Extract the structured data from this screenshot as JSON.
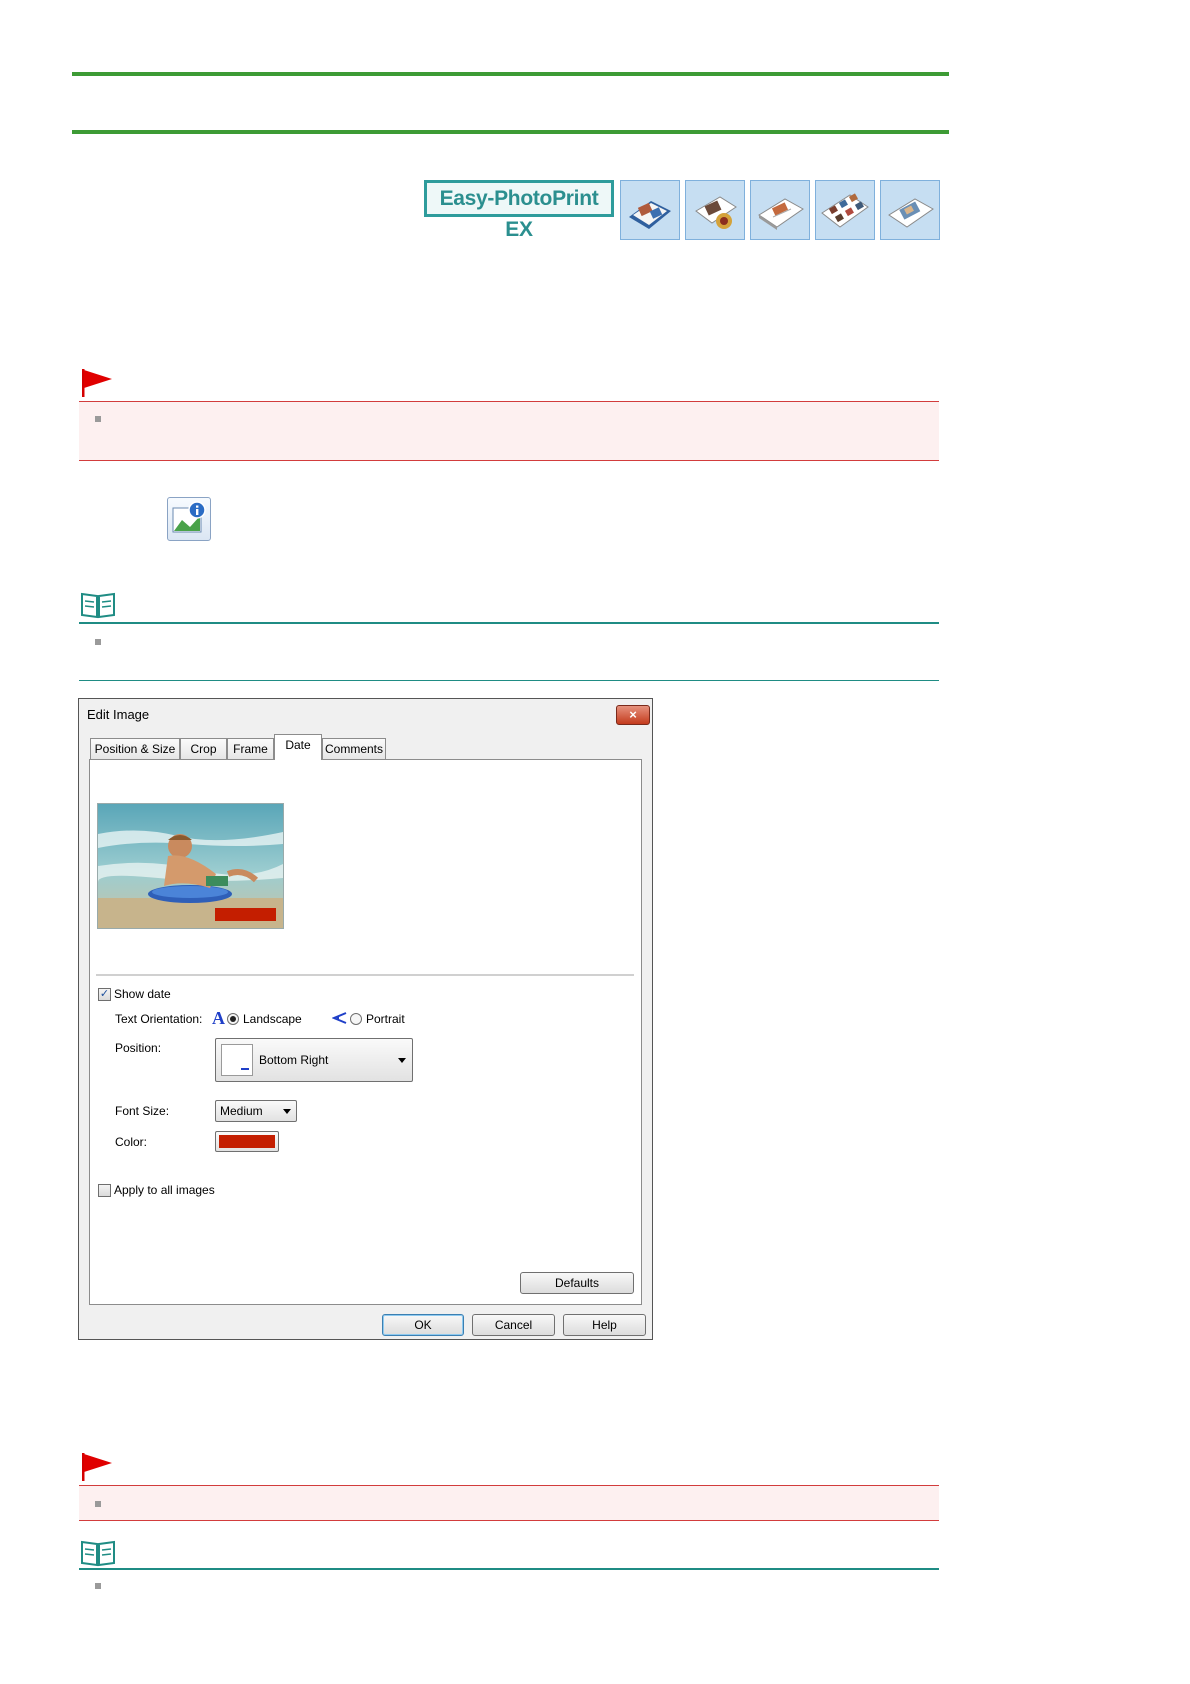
{
  "banner": {
    "logo_text": "Easy-PhotoPrint EX",
    "project_icons": [
      "album-icon",
      "calendar-icon",
      "stickers-icon",
      "layout-print-icon",
      "photo-print-icon"
    ]
  },
  "dialog": {
    "title": "Edit Image",
    "close_label": "×",
    "tabs": [
      {
        "label": "Position & Size"
      },
      {
        "label": "Crop"
      },
      {
        "label": "Frame"
      },
      {
        "label": "Date",
        "active": true
      },
      {
        "label": "Comments"
      }
    ],
    "show_date": {
      "label": "Show date",
      "checked": true
    },
    "text_orientation": {
      "label": "Text Orientation:",
      "options": [
        {
          "label": "Landscape",
          "selected": true
        },
        {
          "label": "Portrait",
          "selected": false
        }
      ]
    },
    "position": {
      "label": "Position:",
      "value": "Bottom Right"
    },
    "font_size": {
      "label": "Font Size:",
      "value": "Medium"
    },
    "color": {
      "label": "Color:",
      "value": "#c41e00"
    },
    "apply_all": {
      "label": "Apply to all images",
      "checked": false
    },
    "defaults_label": "Defaults",
    "ok_label": "OK",
    "cancel_label": "Cancel",
    "help_label": "Help"
  },
  "colors": {
    "rule_green": "#3d9b35",
    "important_red": "#d23c3c",
    "note_teal": "#1f8c84",
    "date_red": "#c41e00"
  }
}
